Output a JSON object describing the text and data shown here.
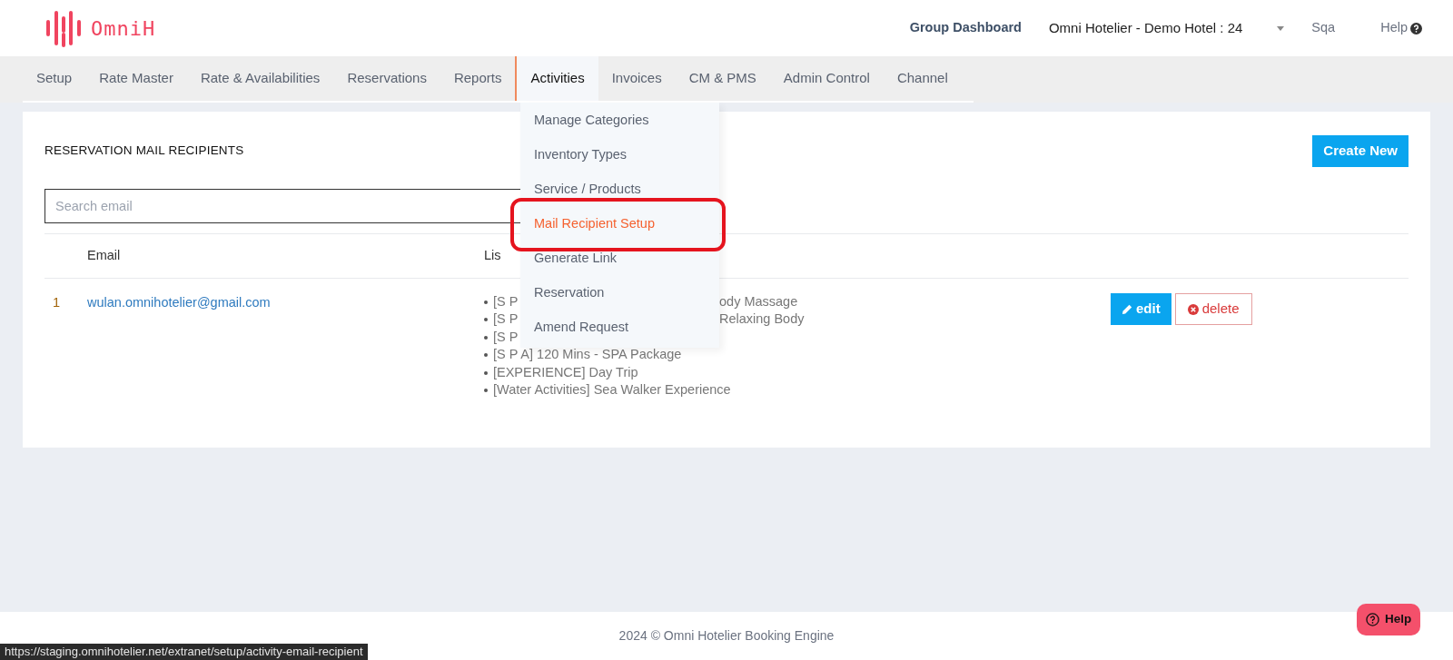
{
  "header": {
    "logo_text": "OmniH",
    "group_dashboard": "Group Dashboard",
    "hotel": "Omni Hotelier - Demo Hotel : 24",
    "user": "Sqa",
    "help": "Help"
  },
  "nav": {
    "tabs": [
      {
        "label": "Setup",
        "selected": false
      },
      {
        "label": "Rate Master",
        "selected": false
      },
      {
        "label": "Rate & Availabilities",
        "selected": false
      },
      {
        "label": "Reservations",
        "selected": false
      },
      {
        "label": "Reports",
        "selected": false
      },
      {
        "label": "Activities",
        "selected": true
      },
      {
        "label": "Invoices",
        "selected": false
      },
      {
        "label": "CM & PMS",
        "selected": false
      },
      {
        "label": "Admin Control",
        "selected": false
      },
      {
        "label": "Channel",
        "selected": false
      }
    ]
  },
  "dropdown": {
    "items": [
      {
        "label": "Manage Categories",
        "selected": false,
        "highlighted": false
      },
      {
        "label": "Inventory Types",
        "selected": false,
        "highlighted": false
      },
      {
        "label": "Service / Products",
        "selected": false,
        "highlighted": false
      },
      {
        "label": "Mail Recipient Setup",
        "selected": true,
        "highlighted": true
      },
      {
        "label": "Generate Link",
        "selected": false,
        "highlighted": false
      },
      {
        "label": "Reservation",
        "selected": false,
        "highlighted": false
      },
      {
        "label": "Amend Request",
        "selected": false,
        "highlighted": false
      }
    ]
  },
  "page": {
    "title": "RESERVATION MAIL RECIPIENTS",
    "create_button": "Create New",
    "search": {
      "placeholder": "Search email"
    },
    "table": {
      "columns": [
        "Email",
        "Lis"
      ],
      "rows": [
        {
          "index": "1",
          "email": "wulan.omnihotelier@gmail.com",
          "list": [
            {
              "left": "[S P",
              "right": "ody Massage"
            },
            {
              "left": "[S P",
              "right": "Relaxing Body"
            },
            {
              "left": "[S P"
            },
            {
              "left": "[S P A] 120 Mins - SPA Package"
            },
            {
              "left": "[EXPERIENCE] Day Trip"
            },
            {
              "left": "[Water Activities] Sea Walker Experience"
            }
          ],
          "actions": [
            {
              "kind": "edit",
              "label": "edit"
            },
            {
              "kind": "delete",
              "label": "delete"
            }
          ]
        }
      ]
    }
  },
  "footer": {
    "text": "2024 © Omni Hotelier Booking Engine"
  },
  "help_button": "Help",
  "status_url": "https://staging.omnihotelier.net/extranet/setup/activity-email-recipient"
}
